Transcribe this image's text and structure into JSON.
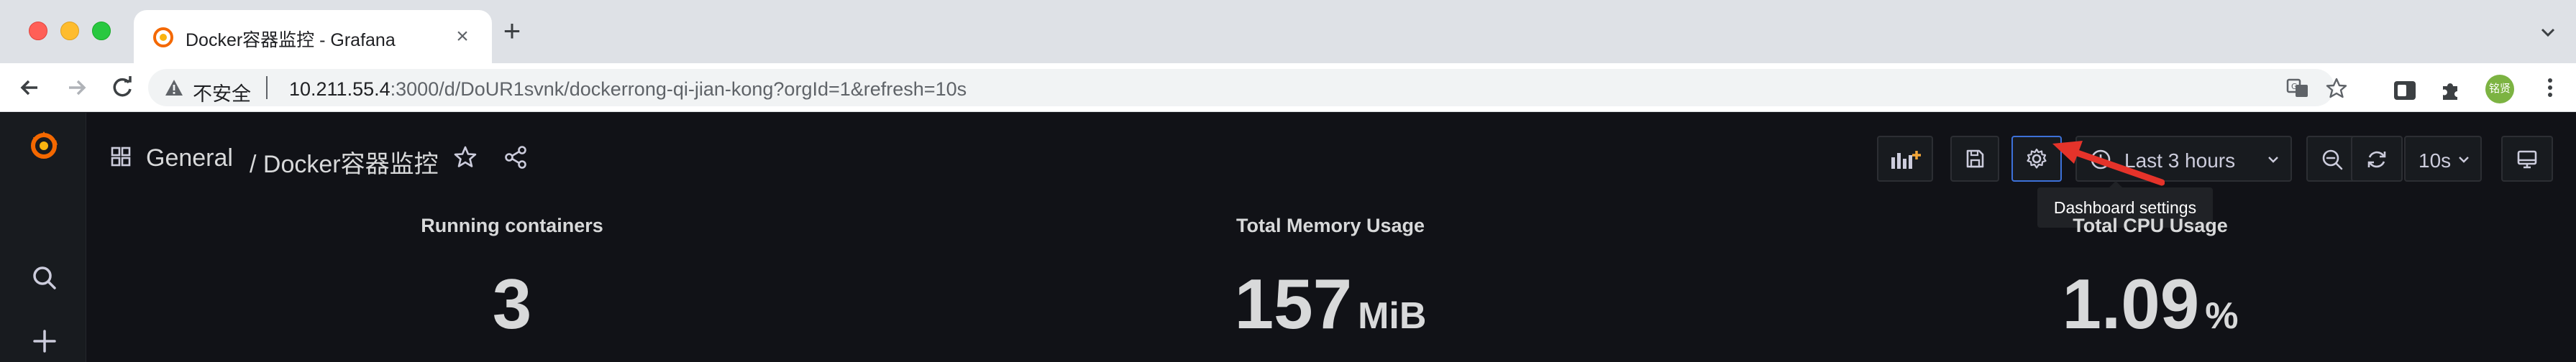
{
  "browser": {
    "tab_title": "Docker容器监控 - Grafana",
    "insecure_label": "不安全",
    "url_host": "10.211.55.4",
    "url_path": ":3000/d/DoUR1svnk/dockerrong-qi-jian-kong?orgId=1&refresh=10s",
    "avatar_text": "铭贤"
  },
  "grafana": {
    "breadcrumb_folder": "General",
    "breadcrumb_dashboard": "/ Docker容器监控",
    "time_range": "Last 3 hours",
    "refresh_interval": "10s",
    "tooltip": "Dashboard settings"
  },
  "panels": [
    {
      "title": "Running containers",
      "value": "3",
      "unit": ""
    },
    {
      "title": "Total Memory Usage",
      "value": "157",
      "unit": "MiB"
    },
    {
      "title": "Total CPU Usage",
      "value": "1.09",
      "unit": "%"
    }
  ],
  "colors": {
    "grafana_bg": "#111217",
    "grafana_text": "#d8d9da",
    "annotation_arrow": "#e5332a",
    "grafana_logo": "#f46800"
  }
}
